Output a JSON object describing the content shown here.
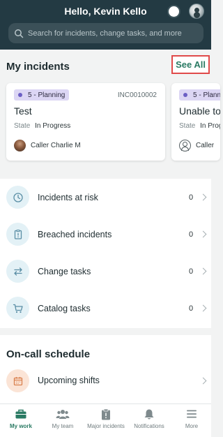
{
  "header": {
    "greeting": "Hello, Kevin Kello",
    "search_placeholder": "Search for incidents, change tasks, and more"
  },
  "incidents": {
    "title": "My incidents",
    "see_all": "See All",
    "cards": [
      {
        "priority": "5 - Planning",
        "number": "INC0010002",
        "title": "Test",
        "state_label": "State",
        "state_value": "In Progress",
        "caller": "Caller Charlie M"
      },
      {
        "priority": "5 - Planning",
        "title": "Unable to",
        "state_label": "State",
        "state_value": "In Progress",
        "caller": "Caller"
      }
    ]
  },
  "lists": [
    {
      "label": "Incidents at risk",
      "count": "0",
      "icon": "clock-icon"
    },
    {
      "label": "Breached incidents",
      "count": "0",
      "icon": "alert-clipboard-icon"
    },
    {
      "label": "Change tasks",
      "count": "0",
      "icon": "swap-arrows-icon"
    },
    {
      "label": "Catalog tasks",
      "count": "0",
      "icon": "cart-icon"
    }
  ],
  "oncall": {
    "title": "On-call schedule",
    "upcoming": "Upcoming shifts"
  },
  "nav": [
    {
      "label": "My work",
      "icon": "briefcase-icon",
      "active": true
    },
    {
      "label": "My team",
      "icon": "team-icon"
    },
    {
      "label": "Major incidents",
      "icon": "clipboard-alert-icon"
    },
    {
      "label": "Notifications",
      "icon": "bell-icon"
    },
    {
      "label": "More",
      "icon": "menu-icon"
    }
  ],
  "colors": {
    "header_bg": "#233a43",
    "accent": "#2a7a63",
    "highlight_border": "#e04a4a",
    "priority_bg": "#dcd6f4"
  }
}
